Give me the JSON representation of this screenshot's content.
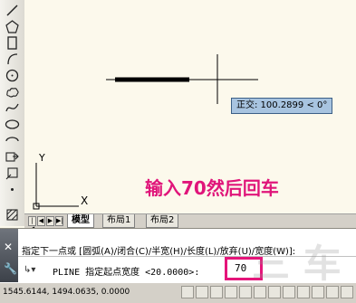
{
  "canvas": {
    "tooltip_label": "正交: 100.2899 < 0°",
    "annotation": "输入70然后回车",
    "ucs_y_label": "Y",
    "ucs_x_label": "X"
  },
  "layout_tabs": {
    "items": [
      "模型",
      "布局1",
      "布局2"
    ],
    "active": "模型"
  },
  "command": {
    "history_line": "指定下一点或 [圆弧(A)/闭合(C)/半宽(H)/长度(L)/放弃(U)/宽度(W)]:",
    "prompt": "PLINE 指定起点宽度 <20.0000>:",
    "input_value": "70"
  },
  "status": {
    "coordinates": "1545.6144, 1494.0635, 0.0000"
  },
  "colors": {
    "canvas_bg": "#fcf9ec",
    "highlight": "#e5157a",
    "tooltip_bg": "#a8c4e0"
  }
}
